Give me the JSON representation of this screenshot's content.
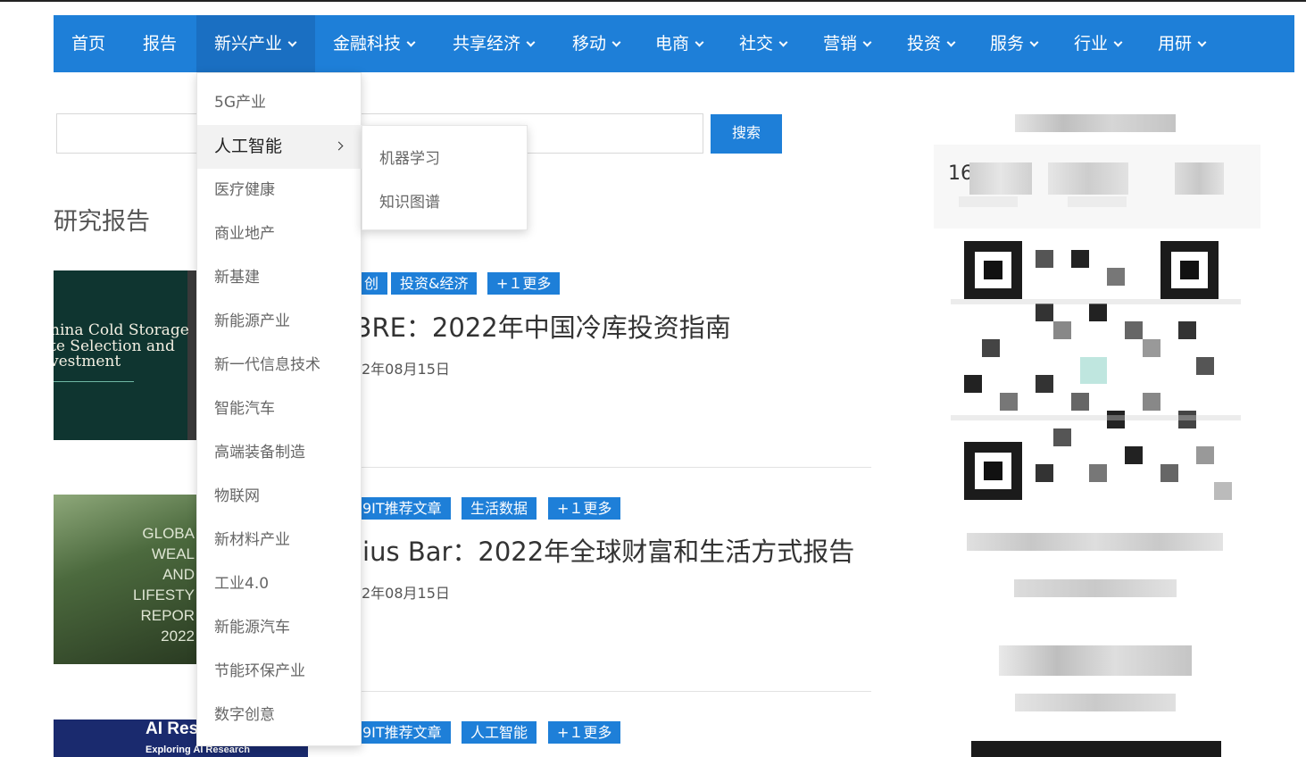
{
  "nav": {
    "items": [
      {
        "label": "首页",
        "has_dropdown": false
      },
      {
        "label": "报告",
        "has_dropdown": false
      },
      {
        "label": "新兴产业",
        "has_dropdown": true,
        "active": true
      },
      {
        "label": "金融科技",
        "has_dropdown": true
      },
      {
        "label": "共享经济",
        "has_dropdown": true
      },
      {
        "label": "移动",
        "has_dropdown": true
      },
      {
        "label": "电商",
        "has_dropdown": true
      },
      {
        "label": "社交",
        "has_dropdown": true
      },
      {
        "label": "营销",
        "has_dropdown": true
      },
      {
        "label": "投资",
        "has_dropdown": true
      },
      {
        "label": "服务",
        "has_dropdown": true
      },
      {
        "label": "行业",
        "has_dropdown": true
      },
      {
        "label": "用研",
        "has_dropdown": true
      }
    ]
  },
  "search": {
    "placeholder": "",
    "button_label": "搜索"
  },
  "section_title": "研究报告",
  "dropdown": {
    "items": [
      {
        "label": "5G产业"
      },
      {
        "label": "人工智能",
        "active": true,
        "has_submenu": true
      },
      {
        "label": "医疗健康"
      },
      {
        "label": "商业地产"
      },
      {
        "label": "新基建"
      },
      {
        "label": "新能源产业"
      },
      {
        "label": "新一代信息技术"
      },
      {
        "label": "智能汽车"
      },
      {
        "label": "高端装备制造"
      },
      {
        "label": "物联网"
      },
      {
        "label": "新材料产业"
      },
      {
        "label": "工业4.0"
      },
      {
        "label": "新能源汽车"
      },
      {
        "label": "节能环保产业"
      },
      {
        "label": "数字创意"
      }
    ],
    "submenu": [
      {
        "label": "机器学习"
      },
      {
        "label": "知识图谱"
      }
    ]
  },
  "articles": [
    {
      "tags": [
        "创",
        "投资&经济",
        "+１更多"
      ],
      "title": "3RE：2022年中国冷库投资指南",
      "date": "2年08月15日",
      "thumb_lines": [
        "hina Cold Storage",
        "te Selection and",
        "vestment"
      ]
    },
    {
      "tags": [
        "9IT推荐文章",
        "生活数据",
        "+１更多"
      ],
      "title": "lius Bar：2022年全球财富和生活方式报告",
      "date": "2年08月15日",
      "thumb_lines": [
        "GLOBA",
        "WEAL",
        "AND",
        "LIFESTY",
        "REPOR",
        "2022"
      ]
    },
    {
      "tags": [
        "9IT推荐文章",
        "人工智能",
        "+１更多"
      ],
      "thumb_lines": [
        "AI Res",
        "Exploring AI Research"
      ]
    }
  ],
  "sidebar": {
    "stat_number_partial": "16"
  },
  "colors": {
    "primary": "#1e7fd8",
    "nav_active": "#1a6fc2",
    "dropdown_active_bg": "#f2f2f2"
  }
}
